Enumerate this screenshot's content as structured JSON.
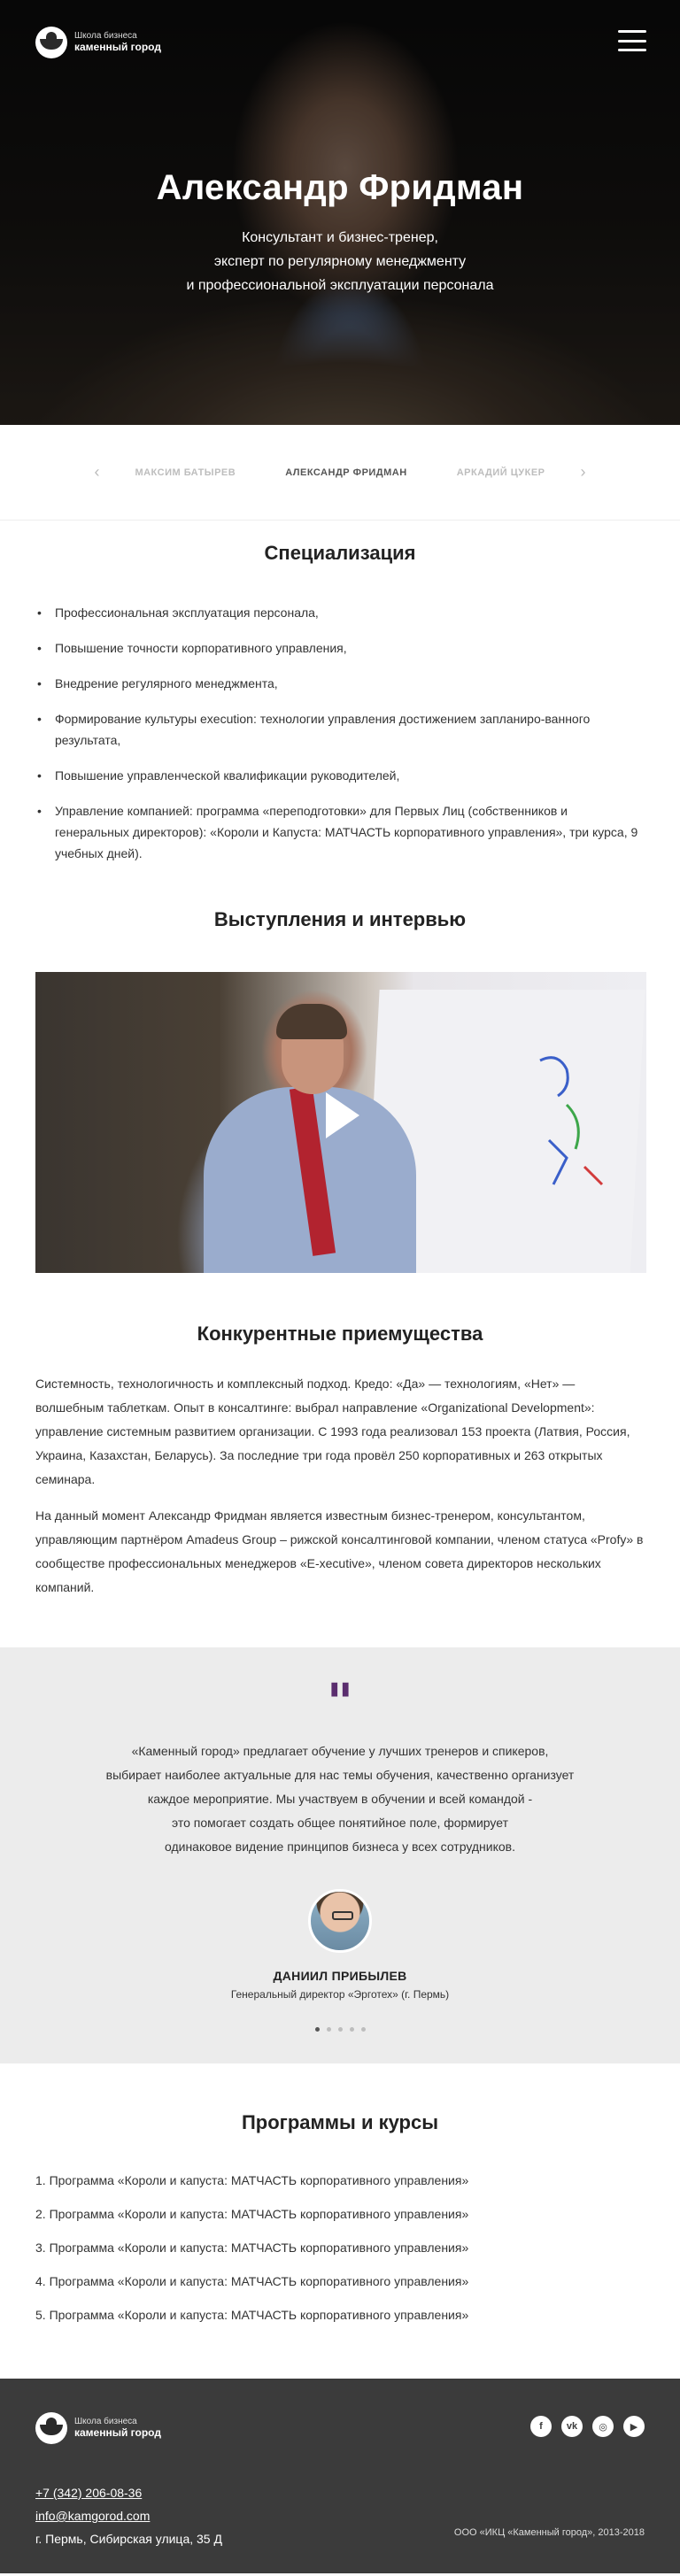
{
  "header": {
    "logo_small": "Школа бизнеса",
    "logo_big": "каменный город"
  },
  "hero": {
    "title": "Александр Фридман",
    "subtitle_lines": [
      "Консультант и бизнес-тренер,",
      "эксперт по регулярному менеджменту",
      "и профессиональной эксплуатации персонала"
    ]
  },
  "tabs": {
    "prev": "‹",
    "next": "›",
    "items": [
      "Максим Батырев",
      "Александр Фридман",
      "Аркадий Цукер"
    ],
    "active": "Александр Фридман"
  },
  "specialization": {
    "title": "Специализация",
    "items": [
      "Профессиональная эксплуатация персонала,",
      "Повышение точности корпоративного управления,",
      "Внедрение регулярного менеджмента,",
      "Формирование культуры execution: технологии  управления достижением запланиро-ванного результата,",
      "Повышение управленческой квалификации руководителей,",
      "Управление компанией: программа «переподготовки» для Первых Лиц (собственников и генеральных директоров): «Короли и Капуста: МАТЧАСТЬ корпоративного управления», три курса, 9 учебных дней)."
    ]
  },
  "talks": {
    "title": "Выступления и интервью"
  },
  "advantages": {
    "title": "Конкурентные приемущества",
    "p1": "Системность, технологичность и комплексный подход.  Кредо: «Да» — технологиям, «Нет» — волшебным таблеткам. Опыт в консалтинге: выбрал направление «Organizational Development»: управление системным развитием организации. С 1993 года реализовал 153 проекта (Латвия, Россия, Украина, Казахстан, Беларусь). За последние три года провёл 250 корпоративных и 263 открытых семинара.",
    "p2": "На данный момент Александр Фридман является известным бизнес-тренером, консультантом, управляющим партнёром Amadeus Group – рижской консалтинговой компании, членом статуса «Profy» в сообществе профессиональных менеджеров «E-xecutive», членом совета директоров нескольких компаний."
  },
  "testimonial": {
    "mark": "\"",
    "lines": [
      "«Каменный город» предлагает обучение у лучших тренеров и спикеров,",
      "выбирает наиболее актуальные для нас темы обучения, качественно организует",
      "каждое мероприятие. Мы участвуем в обучении и всей командой -",
      "это помогает создать общее понятийное поле, формирует",
      "одинаковое видение принципов бизнеса у всех сотрудников."
    ],
    "name": "Даниил Прибылев",
    "role": "Генеральный директор «Эрготех» (г. Пермь)",
    "dots": 5,
    "active_dot": 1
  },
  "programs": {
    "title": "Программы и курсы",
    "items": [
      "1. Программа «Короли и капуста: МАТЧАСТЬ корпоративного управления»",
      "2. Программа «Короли и капуста: МАТЧАСТЬ корпоративного управления»",
      "3. Программа «Короли и капуста: МАТЧАСТЬ корпоративного управления»",
      "4. Программа «Короли и капуста: МАТЧАСТЬ корпоративного управления»",
      "5. Программа «Короли и капуста: МАТЧАСТЬ корпоративного управления»"
    ]
  },
  "footer": {
    "logo_small": "Школа бизнеса",
    "logo_big": "каменный город",
    "phone": "+7 (342) 206-08-36",
    "email": "info@kamgorod.com",
    "address": "г. Пермь, Сибирская улица, 35 Д",
    "copyright": "ООО «ИКЦ «Каменный город», 2013-2018",
    "socials": [
      {
        "icon": "facebook-icon",
        "glyph": "f"
      },
      {
        "icon": "vk-icon",
        "glyph": "vk"
      },
      {
        "icon": "instagram-icon",
        "glyph": "◎"
      },
      {
        "icon": "youtube-icon",
        "glyph": "▶"
      }
    ]
  },
  "colors": {
    "accent": "#5a2d6e",
    "footer_bg": "#3b3b3b",
    "quote_bg": "#ececec"
  }
}
